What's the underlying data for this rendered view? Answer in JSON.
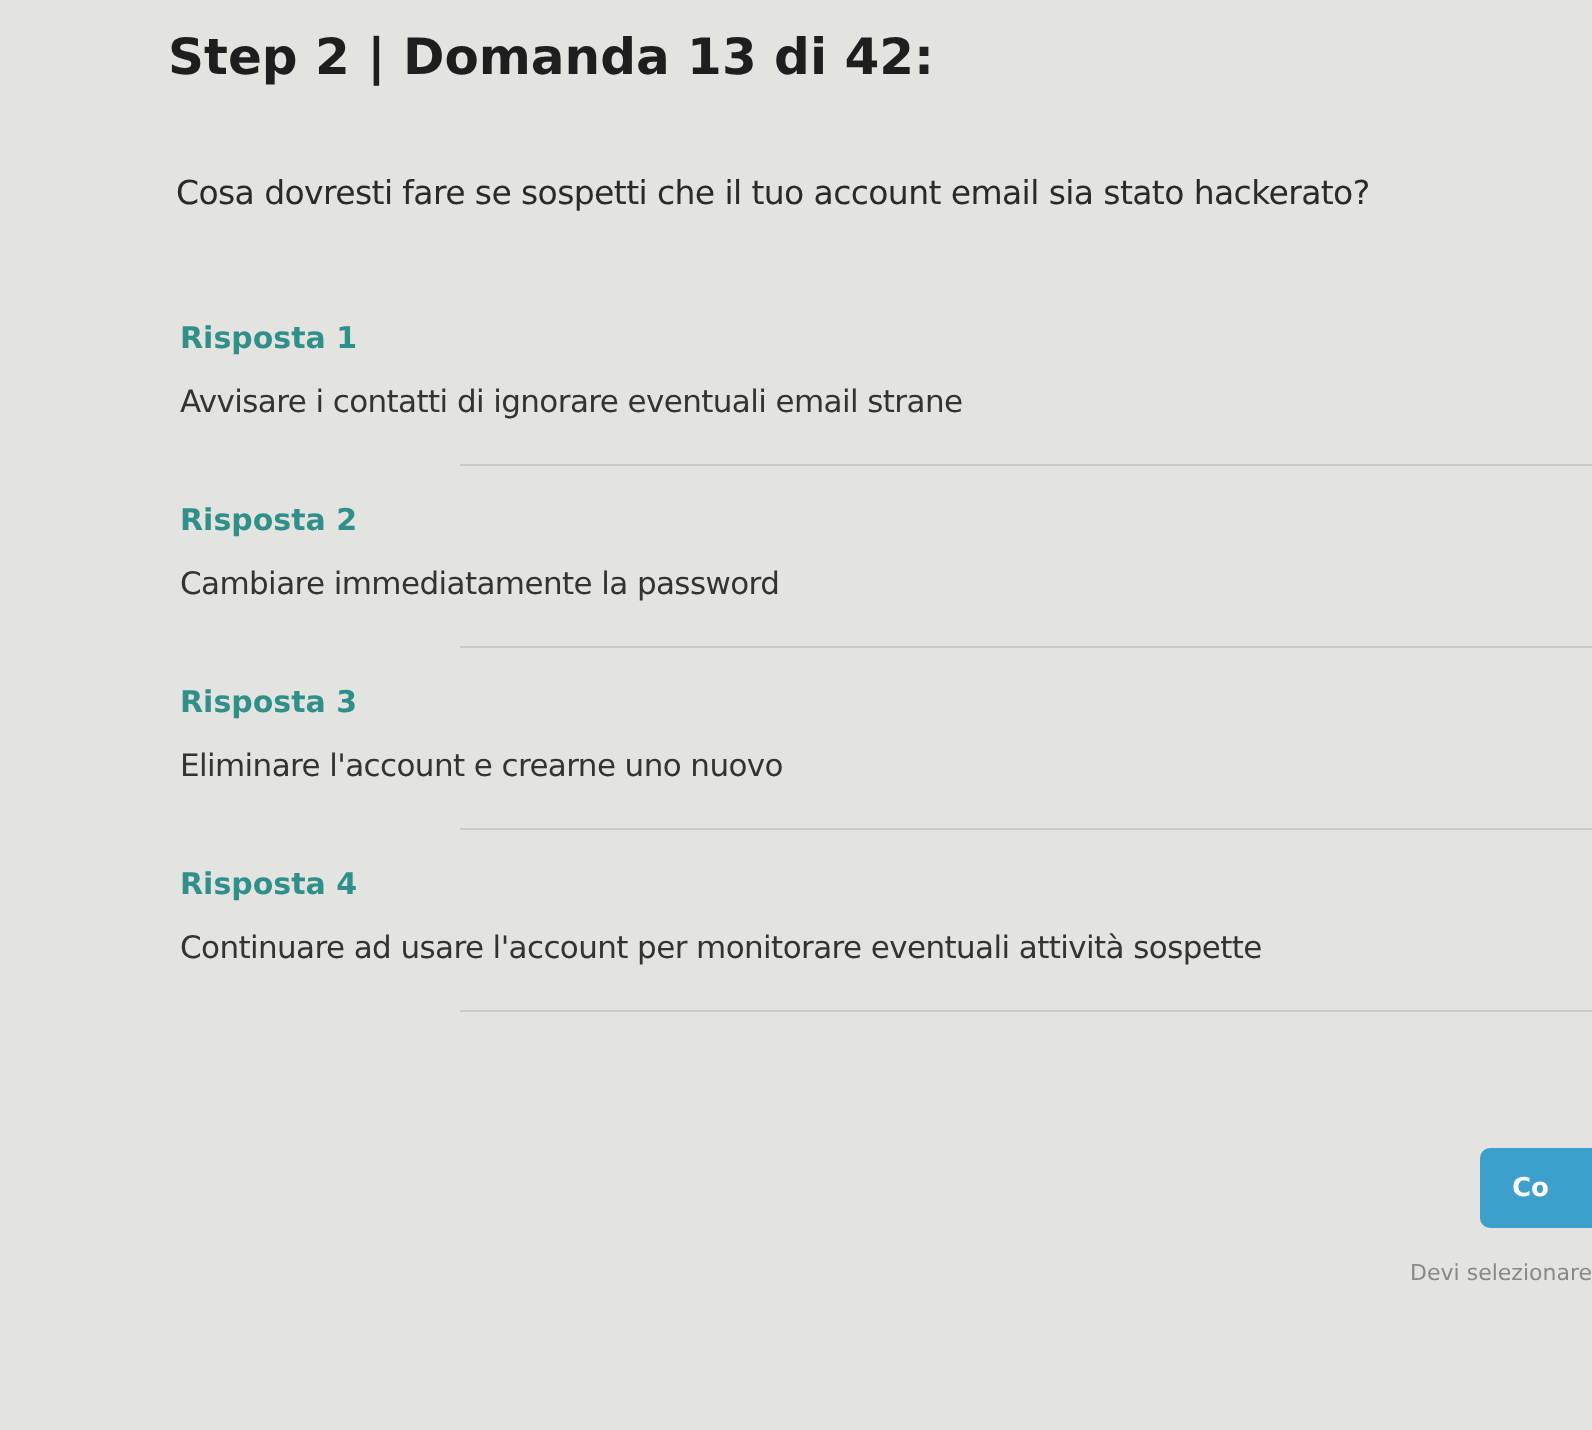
{
  "title": "Step 2 | Domanda 13 di 42:",
  "question": "Cosa dovresti fare se sospetti che il tuo account email sia stato hackerato?",
  "answers": [
    {
      "label": "Risposta 1",
      "text": "Avvisare i contatti di ignorare eventuali email strane"
    },
    {
      "label": "Risposta 2",
      "text": "Cambiare immediatamente la password"
    },
    {
      "label": "Risposta 3",
      "text": "Eliminare l'account e crearne uno nuovo"
    },
    {
      "label": "Risposta 4",
      "text": "Continuare ad usare l'account per monitorare eventuali attività sospette"
    }
  ],
  "button": "Co",
  "hint": "Devi selezionare"
}
